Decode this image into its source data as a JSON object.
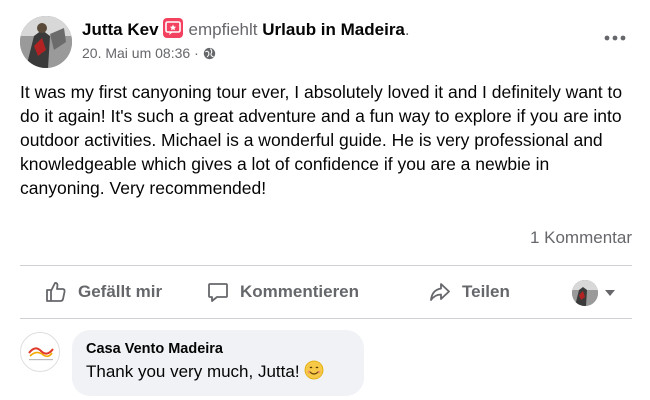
{
  "post": {
    "author_name": "Jutta Kev",
    "recommend_verb": "empfiehlt",
    "page_name": "Urlaub in Madeira",
    "page_suffix": ".",
    "timestamp": "20. Mai um 08:36",
    "separator": "·",
    "body": "It was my first canyoning tour ever, I absolutely loved it and I definitely want to do it again! It's such a great adventure and a fun way to explore if you are into outdoor activities. Michael is a wonderful guide. He is very professional and knowledgeable which gives a lot of confidence if you are a newbie in canyoning. Very recommended!",
    "comment_count": "1 Kommentar"
  },
  "actions": {
    "like_label": "Gefällt mir",
    "comment_label": "Kommentieren",
    "share_label": "Teilen"
  },
  "comment": {
    "author": "Casa Vento Madeira",
    "text": "Thank you very much, Jutta!"
  },
  "icons": {
    "recommend": "recommend-badge-icon",
    "privacy": "globe-icon",
    "more": "more-horizontal-icon",
    "like": "thumbs-up-icon",
    "comment": "speech-bubble-icon",
    "share": "share-arrow-icon",
    "dropdown": "caret-down-icon",
    "emoji": "smiling-face-emoji"
  },
  "colors": {
    "recommend_badge": "#f3425f",
    "secondary_text": "#65676b",
    "bubble_bg": "#f0f2f5",
    "divider": "#ced0d4"
  }
}
